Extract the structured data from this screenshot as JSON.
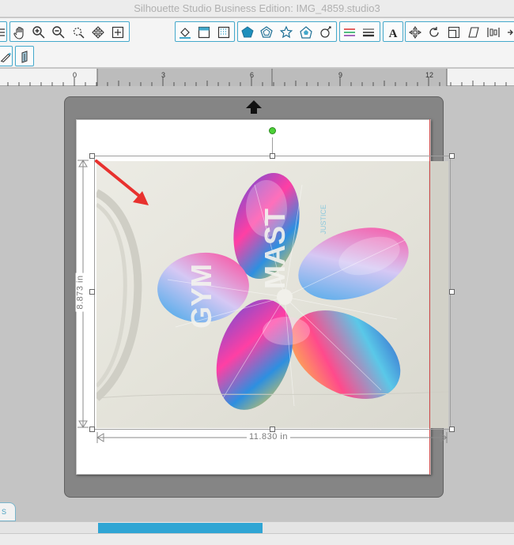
{
  "window": {
    "title": "Silhouette Studio Business Edition: IMG_4859.studio3"
  },
  "toolbar_row1": {
    "view_tools": [
      "hand-icon",
      "zoom-in-icon",
      "zoom-out-icon",
      "zoom-selection-icon",
      "pan-drag-icon",
      "fit-to-page-icon"
    ],
    "panel_tools": [
      "fill-color-icon",
      "line-color-icon",
      "fill-pattern-icon"
    ],
    "shape_tools": [
      "pentagon-icon",
      "pentagon-outline-icon",
      "star-outline-icon",
      "shape-library-icon",
      "sketch-icon"
    ],
    "line_tools": [
      "line-style-icon",
      "line-width-icon"
    ],
    "text_tools": [
      "text-style-icon"
    ],
    "transform_tools": [
      "transform-icon",
      "rotate-icon",
      "scale-icon",
      "shear-icon",
      "align-icon"
    ]
  },
  "toolbar_row2": {
    "tools": [
      "knife-icon",
      "offset-icon"
    ]
  },
  "ruler": {
    "labels": [
      "0",
      "3",
      "6",
      "9",
      "12"
    ]
  },
  "selection": {
    "width_label": "11.830 in",
    "height_label": "8.873 in"
  },
  "image_text": {
    "left_letters": "GYM",
    "right_letters": "MAST",
    "small_text": "JUSTICE"
  },
  "bottom": {
    "tab_label": "S",
    "scroll_position": 0.32
  },
  "colors": {
    "accent": "#43a8cb",
    "scroll_thumb": "#2fa5d4",
    "cut_line": "#d04848",
    "arrow": "#e8312e",
    "rotate_handle": "#4cd137"
  }
}
